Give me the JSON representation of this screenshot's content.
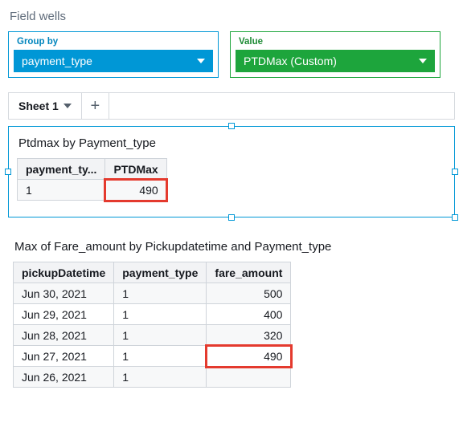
{
  "fieldWells": {
    "title": "Field wells",
    "group": {
      "label": "Group by",
      "value": "payment_type"
    },
    "value": {
      "label": "Value",
      "value": "PTDMax (Custom)"
    }
  },
  "sheets": {
    "active": "Sheet 1"
  },
  "viz1": {
    "title": "Ptdmax by Payment_type",
    "headers": [
      "payment_ty...",
      "PTDMax"
    ],
    "rows": [
      [
        "1",
        "490"
      ]
    ],
    "highlighted": [
      [
        0,
        1
      ]
    ]
  },
  "viz2": {
    "title": "Max of Fare_amount by Pickupdatetime and Payment_type",
    "headers": [
      "pickupDatetime",
      "payment_type",
      "fare_amount"
    ],
    "rows": [
      [
        "Jun 30, 2021",
        "1",
        "500"
      ],
      [
        "Jun 29, 2021",
        "1",
        "400"
      ],
      [
        "Jun 28, 2021",
        "1",
        "320"
      ],
      [
        "Jun 27, 2021",
        "1",
        "490"
      ],
      [
        "Jun 26, 2021",
        "1",
        ""
      ]
    ],
    "highlighted": [
      [
        3,
        2
      ]
    ]
  }
}
